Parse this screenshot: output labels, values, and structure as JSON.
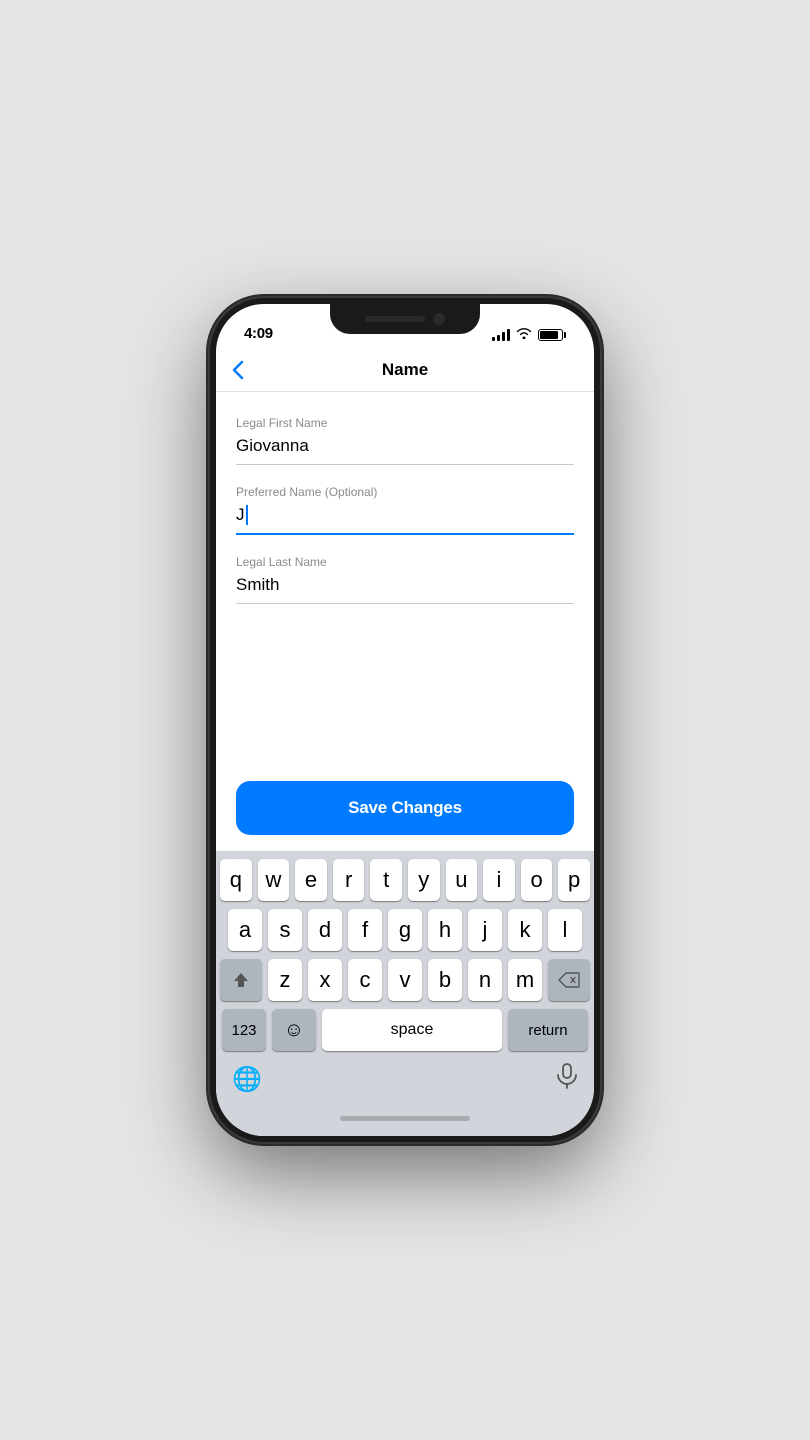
{
  "status": {
    "time": "4:09"
  },
  "nav": {
    "back_label": "‹",
    "title": "Name"
  },
  "form": {
    "fields": [
      {
        "id": "legal-first-name",
        "label": "Legal First Name",
        "value": "Giovanna",
        "active": false
      },
      {
        "id": "preferred-name",
        "label": "Preferred Name (Optional)",
        "value": "J",
        "active": true
      },
      {
        "id": "legal-last-name",
        "label": "Legal Last Name",
        "value": "Smith",
        "active": false
      }
    ]
  },
  "save_button": {
    "label": "Save Changes"
  },
  "keyboard": {
    "rows": [
      [
        "q",
        "w",
        "e",
        "r",
        "t",
        "y",
        "u",
        "i",
        "o",
        "p"
      ],
      [
        "a",
        "s",
        "d",
        "f",
        "g",
        "h",
        "j",
        "k",
        "l"
      ],
      [
        "z",
        "x",
        "c",
        "v",
        "b",
        "n",
        "m"
      ]
    ],
    "space_label": "space",
    "return_label": "return",
    "num_label": "123"
  }
}
